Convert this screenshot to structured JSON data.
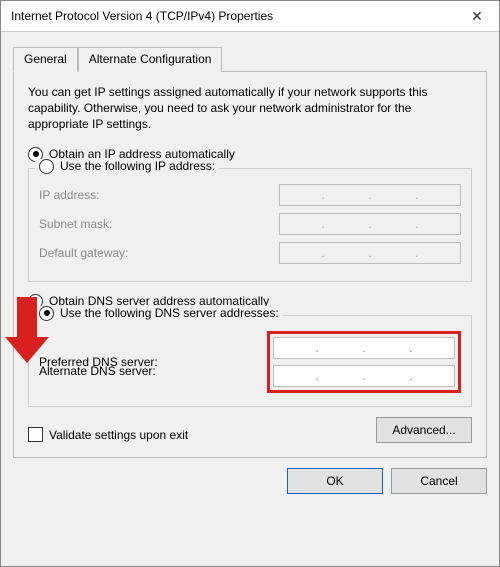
{
  "window": {
    "title": "Internet Protocol Version 4 (TCP/IPv4) Properties"
  },
  "tabs": {
    "general": "General",
    "alt": "Alternate Configuration"
  },
  "intro": "You can get IP settings assigned automatically if your network supports this capability. Otherwise, you need to ask your network administrator for the appropriate IP settings.",
  "ip": {
    "auto": "Obtain an IP address automatically",
    "manual": "Use the following IP address:",
    "ip_label": "IP address:",
    "subnet_label": "Subnet mask:",
    "gateway_label": "Default gateway:"
  },
  "dns": {
    "auto": "Obtain DNS server address automatically",
    "manual": "Use the following DNS server addresses:",
    "preferred_label": "Preferred DNS server:",
    "alternate_label": "Alternate DNS server:"
  },
  "validate": "Validate settings upon exit",
  "buttons": {
    "advanced": "Advanced...",
    "ok": "OK",
    "cancel": "Cancel"
  },
  "dot": "."
}
